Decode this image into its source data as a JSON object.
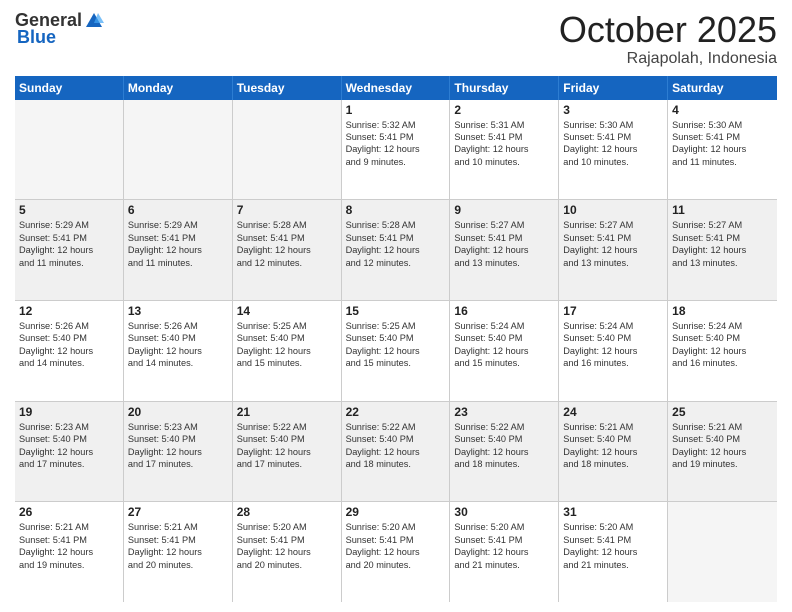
{
  "header": {
    "logo_general": "General",
    "logo_blue": "Blue",
    "month_title": "October 2025",
    "location": "Rajapolah, Indonesia"
  },
  "days_of_week": [
    "Sunday",
    "Monday",
    "Tuesday",
    "Wednesday",
    "Thursday",
    "Friday",
    "Saturday"
  ],
  "weeks": [
    [
      {
        "day": "",
        "info": "",
        "empty": true
      },
      {
        "day": "",
        "info": "",
        "empty": true
      },
      {
        "day": "",
        "info": "",
        "empty": true
      },
      {
        "day": "1",
        "info": "Sunrise: 5:32 AM\nSunset: 5:41 PM\nDaylight: 12 hours\nand 9 minutes."
      },
      {
        "day": "2",
        "info": "Sunrise: 5:31 AM\nSunset: 5:41 PM\nDaylight: 12 hours\nand 10 minutes."
      },
      {
        "day": "3",
        "info": "Sunrise: 5:30 AM\nSunset: 5:41 PM\nDaylight: 12 hours\nand 10 minutes."
      },
      {
        "day": "4",
        "info": "Sunrise: 5:30 AM\nSunset: 5:41 PM\nDaylight: 12 hours\nand 11 minutes."
      }
    ],
    [
      {
        "day": "5",
        "info": "Sunrise: 5:29 AM\nSunset: 5:41 PM\nDaylight: 12 hours\nand 11 minutes."
      },
      {
        "day": "6",
        "info": "Sunrise: 5:29 AM\nSunset: 5:41 PM\nDaylight: 12 hours\nand 11 minutes."
      },
      {
        "day": "7",
        "info": "Sunrise: 5:28 AM\nSunset: 5:41 PM\nDaylight: 12 hours\nand 12 minutes."
      },
      {
        "day": "8",
        "info": "Sunrise: 5:28 AM\nSunset: 5:41 PM\nDaylight: 12 hours\nand 12 minutes."
      },
      {
        "day": "9",
        "info": "Sunrise: 5:27 AM\nSunset: 5:41 PM\nDaylight: 12 hours\nand 13 minutes."
      },
      {
        "day": "10",
        "info": "Sunrise: 5:27 AM\nSunset: 5:41 PM\nDaylight: 12 hours\nand 13 minutes."
      },
      {
        "day": "11",
        "info": "Sunrise: 5:27 AM\nSunset: 5:41 PM\nDaylight: 12 hours\nand 13 minutes."
      }
    ],
    [
      {
        "day": "12",
        "info": "Sunrise: 5:26 AM\nSunset: 5:40 PM\nDaylight: 12 hours\nand 14 minutes."
      },
      {
        "day": "13",
        "info": "Sunrise: 5:26 AM\nSunset: 5:40 PM\nDaylight: 12 hours\nand 14 minutes."
      },
      {
        "day": "14",
        "info": "Sunrise: 5:25 AM\nSunset: 5:40 PM\nDaylight: 12 hours\nand 15 minutes."
      },
      {
        "day": "15",
        "info": "Sunrise: 5:25 AM\nSunset: 5:40 PM\nDaylight: 12 hours\nand 15 minutes."
      },
      {
        "day": "16",
        "info": "Sunrise: 5:24 AM\nSunset: 5:40 PM\nDaylight: 12 hours\nand 15 minutes."
      },
      {
        "day": "17",
        "info": "Sunrise: 5:24 AM\nSunset: 5:40 PM\nDaylight: 12 hours\nand 16 minutes."
      },
      {
        "day": "18",
        "info": "Sunrise: 5:24 AM\nSunset: 5:40 PM\nDaylight: 12 hours\nand 16 minutes."
      }
    ],
    [
      {
        "day": "19",
        "info": "Sunrise: 5:23 AM\nSunset: 5:40 PM\nDaylight: 12 hours\nand 17 minutes."
      },
      {
        "day": "20",
        "info": "Sunrise: 5:23 AM\nSunset: 5:40 PM\nDaylight: 12 hours\nand 17 minutes."
      },
      {
        "day": "21",
        "info": "Sunrise: 5:22 AM\nSunset: 5:40 PM\nDaylight: 12 hours\nand 17 minutes."
      },
      {
        "day": "22",
        "info": "Sunrise: 5:22 AM\nSunset: 5:40 PM\nDaylight: 12 hours\nand 18 minutes."
      },
      {
        "day": "23",
        "info": "Sunrise: 5:22 AM\nSunset: 5:40 PM\nDaylight: 12 hours\nand 18 minutes."
      },
      {
        "day": "24",
        "info": "Sunrise: 5:21 AM\nSunset: 5:40 PM\nDaylight: 12 hours\nand 18 minutes."
      },
      {
        "day": "25",
        "info": "Sunrise: 5:21 AM\nSunset: 5:40 PM\nDaylight: 12 hours\nand 19 minutes."
      }
    ],
    [
      {
        "day": "26",
        "info": "Sunrise: 5:21 AM\nSunset: 5:41 PM\nDaylight: 12 hours\nand 19 minutes."
      },
      {
        "day": "27",
        "info": "Sunrise: 5:21 AM\nSunset: 5:41 PM\nDaylight: 12 hours\nand 20 minutes."
      },
      {
        "day": "28",
        "info": "Sunrise: 5:20 AM\nSunset: 5:41 PM\nDaylight: 12 hours\nand 20 minutes."
      },
      {
        "day": "29",
        "info": "Sunrise: 5:20 AM\nSunset: 5:41 PM\nDaylight: 12 hours\nand 20 minutes."
      },
      {
        "day": "30",
        "info": "Sunrise: 5:20 AM\nSunset: 5:41 PM\nDaylight: 12 hours\nand 21 minutes."
      },
      {
        "day": "31",
        "info": "Sunrise: 5:20 AM\nSunset: 5:41 PM\nDaylight: 12 hours\nand 21 minutes."
      },
      {
        "day": "",
        "info": "",
        "empty": true
      }
    ]
  ]
}
